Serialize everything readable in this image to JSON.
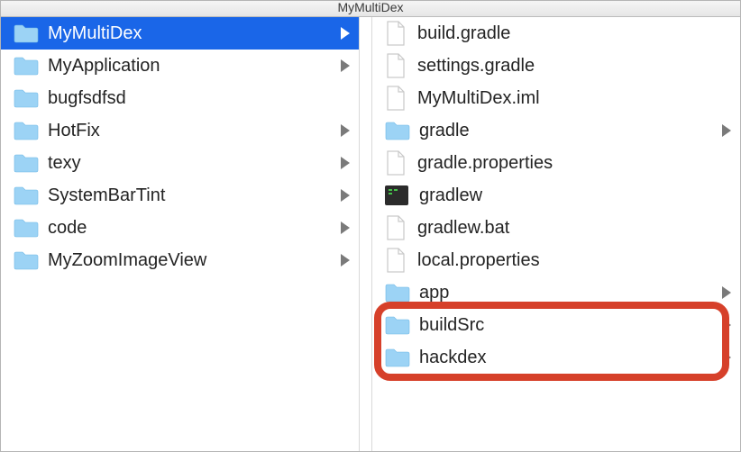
{
  "window": {
    "title": "MyMultiDex"
  },
  "left": {
    "items": [
      {
        "name": "MyMultiDex",
        "type": "folder",
        "selected": true,
        "expandable": true
      },
      {
        "name": "MyApplication",
        "type": "folder",
        "selected": false,
        "expandable": true
      },
      {
        "name": "bugfsdfsd",
        "type": "folder",
        "selected": false,
        "expandable": false
      },
      {
        "name": "HotFix",
        "type": "folder",
        "selected": false,
        "expandable": true
      },
      {
        "name": "texy",
        "type": "folder",
        "selected": false,
        "expandable": true
      },
      {
        "name": "SystemBarTint",
        "type": "folder",
        "selected": false,
        "expandable": true
      },
      {
        "name": "code",
        "type": "folder",
        "selected": false,
        "expandable": true
      },
      {
        "name": "MyZoomImageView",
        "type": "folder",
        "selected": false,
        "expandable": true
      }
    ]
  },
  "right": {
    "items": [
      {
        "name": "build.gradle",
        "type": "file",
        "expandable": false
      },
      {
        "name": "settings.gradle",
        "type": "file",
        "expandable": false
      },
      {
        "name": "MyMultiDex.iml",
        "type": "file",
        "expandable": false
      },
      {
        "name": "gradle",
        "type": "folder",
        "expandable": true
      },
      {
        "name": "gradle.properties",
        "type": "file",
        "expandable": false
      },
      {
        "name": "gradlew",
        "type": "exec",
        "expandable": false
      },
      {
        "name": "gradlew.bat",
        "type": "file",
        "expandable": false
      },
      {
        "name": "local.properties",
        "type": "file",
        "expandable": false
      },
      {
        "name": "app",
        "type": "folder",
        "expandable": true
      },
      {
        "name": "buildSrc",
        "type": "folder",
        "expandable": true
      },
      {
        "name": "hackdex",
        "type": "folder",
        "expandable": true
      }
    ]
  },
  "annotation": {
    "highlight_row_start": 9,
    "highlight_row_end": 10
  }
}
